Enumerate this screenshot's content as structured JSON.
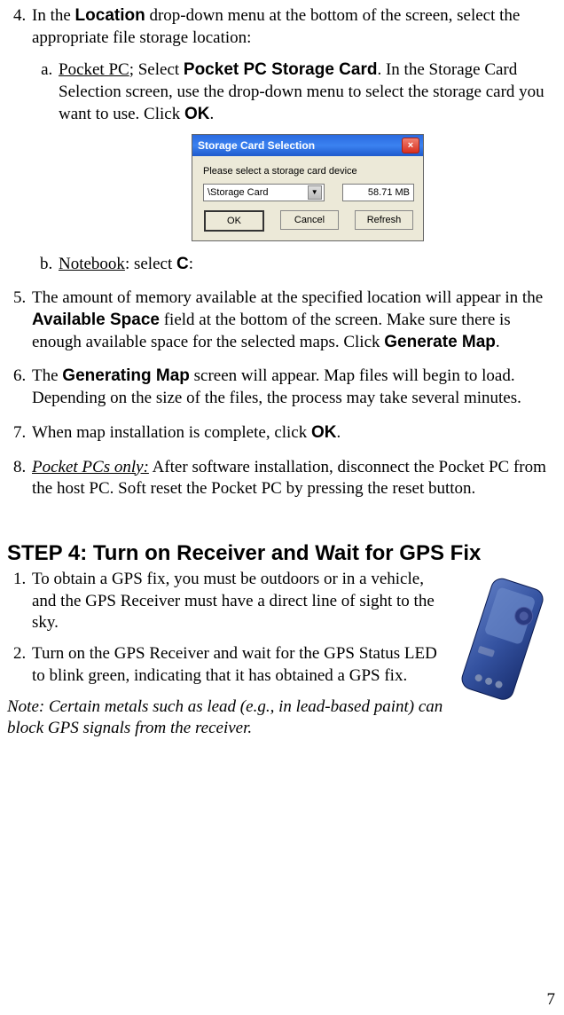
{
  "item4": {
    "pre": "In the ",
    "location": "Location",
    "post": " drop-down menu at the bottom of the screen, select the appropriate file storage location:"
  },
  "sub_a": {
    "pocketpc": "Pocket PC",
    "select_text": "; Select ",
    "storagecard": "Pocket PC Storage Card",
    "rest": ". In the Storage Card Selection screen, use the drop-down menu to select the storage card you want to use. Click ",
    "ok": "OK",
    "period": "."
  },
  "dialog": {
    "title": "Storage Card Selection",
    "label": "Please select a storage card device",
    "selected": "\\Storage Card",
    "size": "58.71 MB",
    "ok": "OK",
    "cancel": "Cancel",
    "refresh": "Refresh"
  },
  "sub_b": {
    "notebook": "Notebook",
    "select_text": ": select ",
    "c": "C",
    "colon": ":"
  },
  "item5": {
    "p1": "The amount of memory available at the specified location will appear in the ",
    "avail": "Available Space",
    "p2": " field at the bottom of the screen. Make sure there is enough available space for the selected maps. Click ",
    "gen": "Generate Map",
    "period": "."
  },
  "item6": {
    "p1": "The ",
    "genmap": "Generating Map",
    "p2": " screen will appear. Map files will begin to load. Depending on the size of the files, the process may take several minutes."
  },
  "item7": {
    "p1": "When map installation is complete, click ",
    "ok": "OK",
    "period": "."
  },
  "item8": {
    "ponly": "Pocket PCs only:",
    "rest": " After software installation, disconnect the Pocket PC from the host PC. Soft reset the Pocket PC by pressing the reset button."
  },
  "step4": {
    "heading": "STEP 4: Turn on Receiver and Wait for GPS Fix",
    "i1": "To obtain a GPS fix, you must be outdoors or in a vehicle, and the GPS Receiver must have a direct line of sight to the sky.",
    "i2": "Turn on the GPS Receiver and wait for the GPS Status LED to blink green, indicating that it has obtained a GPS fix.",
    "note": "Note: Certain metals such as lead (e.g., in lead-based paint) can block GPS signals from the receiver."
  },
  "page": "7"
}
